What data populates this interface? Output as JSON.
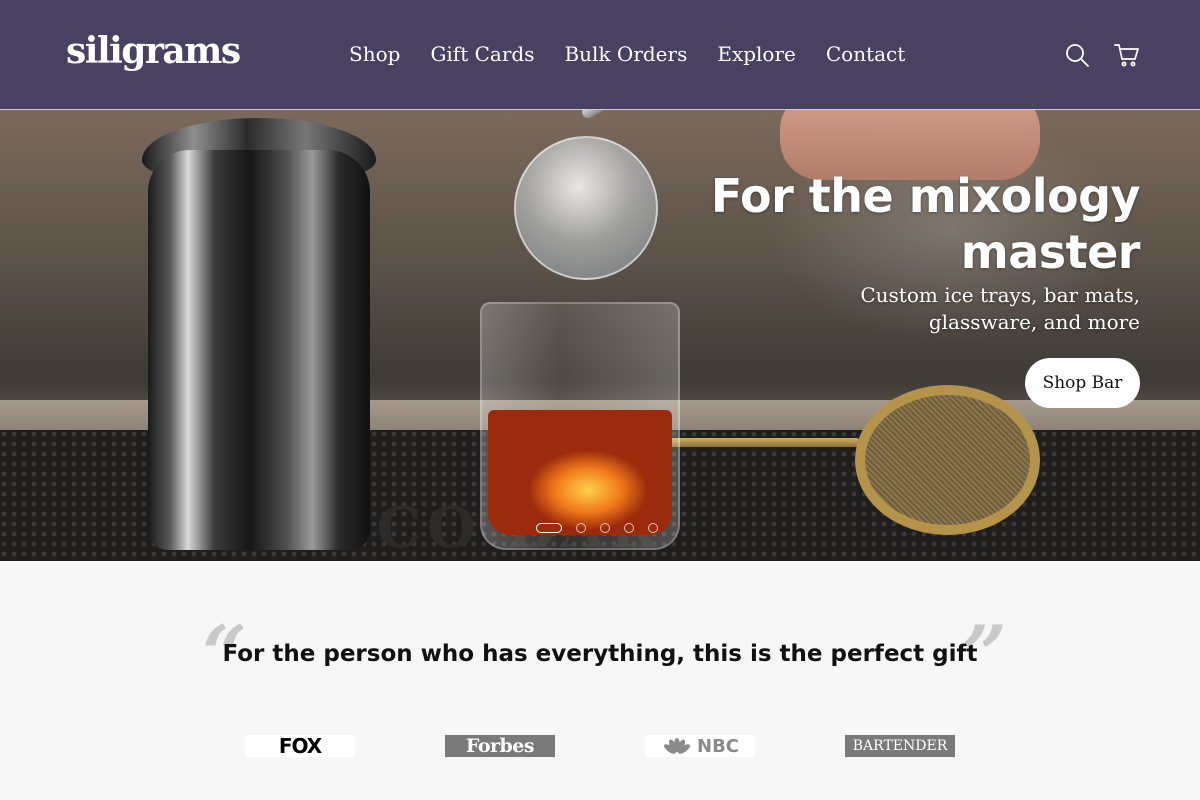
{
  "header": {
    "logo": "siligrams",
    "nav": [
      "Shop",
      "Gift Cards",
      "Bulk Orders",
      "Explore",
      "Contact"
    ],
    "icons": {
      "search": "search-icon",
      "cart": "cart-icon"
    },
    "background": "#4a4162"
  },
  "hero": {
    "title": "For the mixology master",
    "subtitle": "Custom ice trays, bar mats, glassware, and more",
    "cta": "Shop Bar",
    "mat_text": "SCO BAR",
    "slides": {
      "count": 5,
      "active": 1
    }
  },
  "press": {
    "quote": "For the person who has everything, this is the perfect gift",
    "quote_open": "“",
    "quote_close": "”",
    "logos": [
      "FOX",
      "Forbes",
      "NBC",
      "BARTENDER"
    ]
  },
  "colors": {
    "accent": "#4a4162",
    "press_background": "#f6f6f6",
    "quote_mark": "#c9c9c9"
  }
}
